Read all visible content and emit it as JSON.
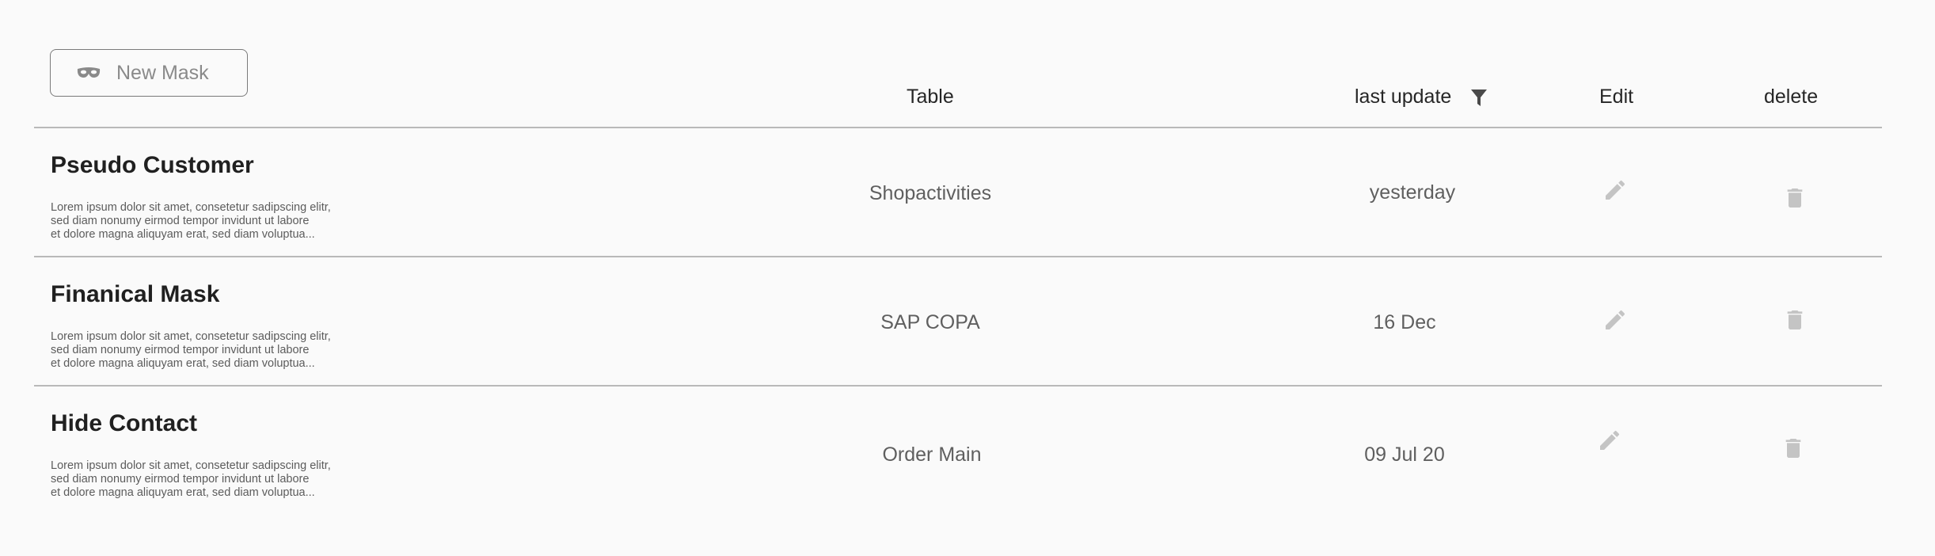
{
  "toolbar": {
    "new_mask_label": "New Mask"
  },
  "table_header": {
    "table": "Table",
    "last_update": "last update",
    "edit": "Edit",
    "delete": "delete"
  },
  "rows": [
    {
      "name": "Pseudo Customer",
      "desc_1": "Lorem ipsum dolor sit amet, consetetur sadipscing elitr,",
      "desc_2": "sed diam nonumy eirmod tempor invidunt ut labore",
      "desc_3": "et dolore magna aliquyam erat, sed diam voluptua...",
      "table": "Shopactivities",
      "last_update": "yesterday"
    },
    {
      "name": "Finanical Mask",
      "desc_1": "Lorem ipsum dolor sit amet, consetetur sadipscing elitr,",
      "desc_2": "sed diam nonumy eirmod tempor invidunt ut labore",
      "desc_3": "et dolore magna aliquyam erat, sed diam voluptua...",
      "table": "SAP COPA",
      "last_update": "16 Dec"
    },
    {
      "name": "Hide Contact",
      "desc_1": "Lorem ipsum dolor sit amet, consetetur sadipscing elitr,",
      "desc_2": "sed diam nonumy eirmod tempor invidunt ut labore",
      "desc_3": "et dolore magna aliquyam erat, sed diam voluptua...",
      "table": "Order Main",
      "last_update": "09 Jul 20"
    }
  ],
  "icons": {
    "new_mask": "mask-icon",
    "filter": "filter-icon",
    "edit": "pencil-icon",
    "delete": "trash-icon"
  },
  "colors": {
    "background": "#fafafa",
    "divider": "#b9b9b9",
    "icon_muted": "#c4c4c4",
    "text_primary": "#212121",
    "text_secondary": "#5f5f5f"
  }
}
